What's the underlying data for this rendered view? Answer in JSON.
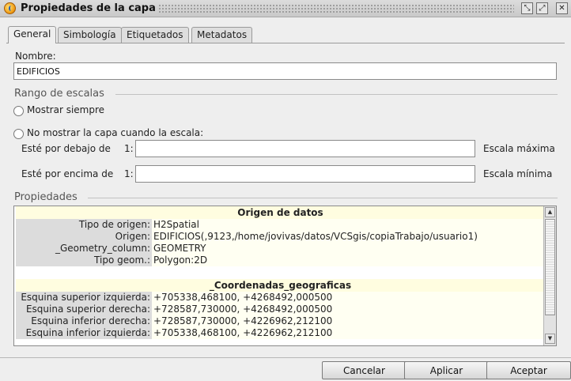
{
  "window": {
    "title": "Propiedades de la capa",
    "minimize_glyph": "⤡",
    "maximize_glyph": "⤢",
    "close_glyph": "✕"
  },
  "tabs": [
    {
      "label": "General",
      "active": true
    },
    {
      "label": "Simbología",
      "active": false
    },
    {
      "label": "Etiquetados",
      "active": false
    },
    {
      "label": "Metadatos",
      "active": false
    }
  ],
  "general": {
    "nombre_label": "Nombre:",
    "nombre_value": "EDIFICIOS",
    "rango_title": "Rango de escalas",
    "mostrar_siempre": "Mostrar siempre",
    "no_mostrar": "No mostrar la capa cuando la escala:",
    "debajo_label": "Esté por debajo de",
    "debajo_prefix": "1:",
    "debajo_value": "",
    "escala_maxima": "Escala máxima",
    "encima_label": "Esté por encima de",
    "encima_prefix": "1:",
    "encima_value": "",
    "escala_minima": "Escala mínima",
    "propiedades_title": "Propiedades"
  },
  "properties": {
    "origen_header": "Origen de datos",
    "origen_rows": [
      {
        "key": "Tipo de origen:",
        "value": "H2Spatial"
      },
      {
        "key": "Origen:",
        "value": "EDIFICIOS(,9123,/home/jovivas/datos/VCSgis/copiaTrabajo/usuario1)"
      },
      {
        "key": "_Geometry_column:",
        "value": "GEOMETRY"
      },
      {
        "key": "Tipo geom.:",
        "value": "Polygon:2D"
      }
    ],
    "coord_header": "_Coordenadas_geograficas",
    "coord_rows": [
      {
        "key": "Esquina superior izquierda:",
        "value": "+705338,468100,  +4268492,000500"
      },
      {
        "key": "Esquina superior derecha:",
        "value": "+728587,730000,  +4268492,000500"
      },
      {
        "key": "Esquina inferior derecha:",
        "value": "+728587,730000,  +4226962,212100"
      },
      {
        "key": "Esquina inferior izquierda:",
        "value": "+705338,468100,  +4226962,212100"
      }
    ]
  },
  "buttons": {
    "cancel": "Cancelar",
    "apply": "Aplicar",
    "accept": "Aceptar"
  },
  "scrollbar": {
    "up_glyph": "▲",
    "down_glyph": "▼"
  }
}
